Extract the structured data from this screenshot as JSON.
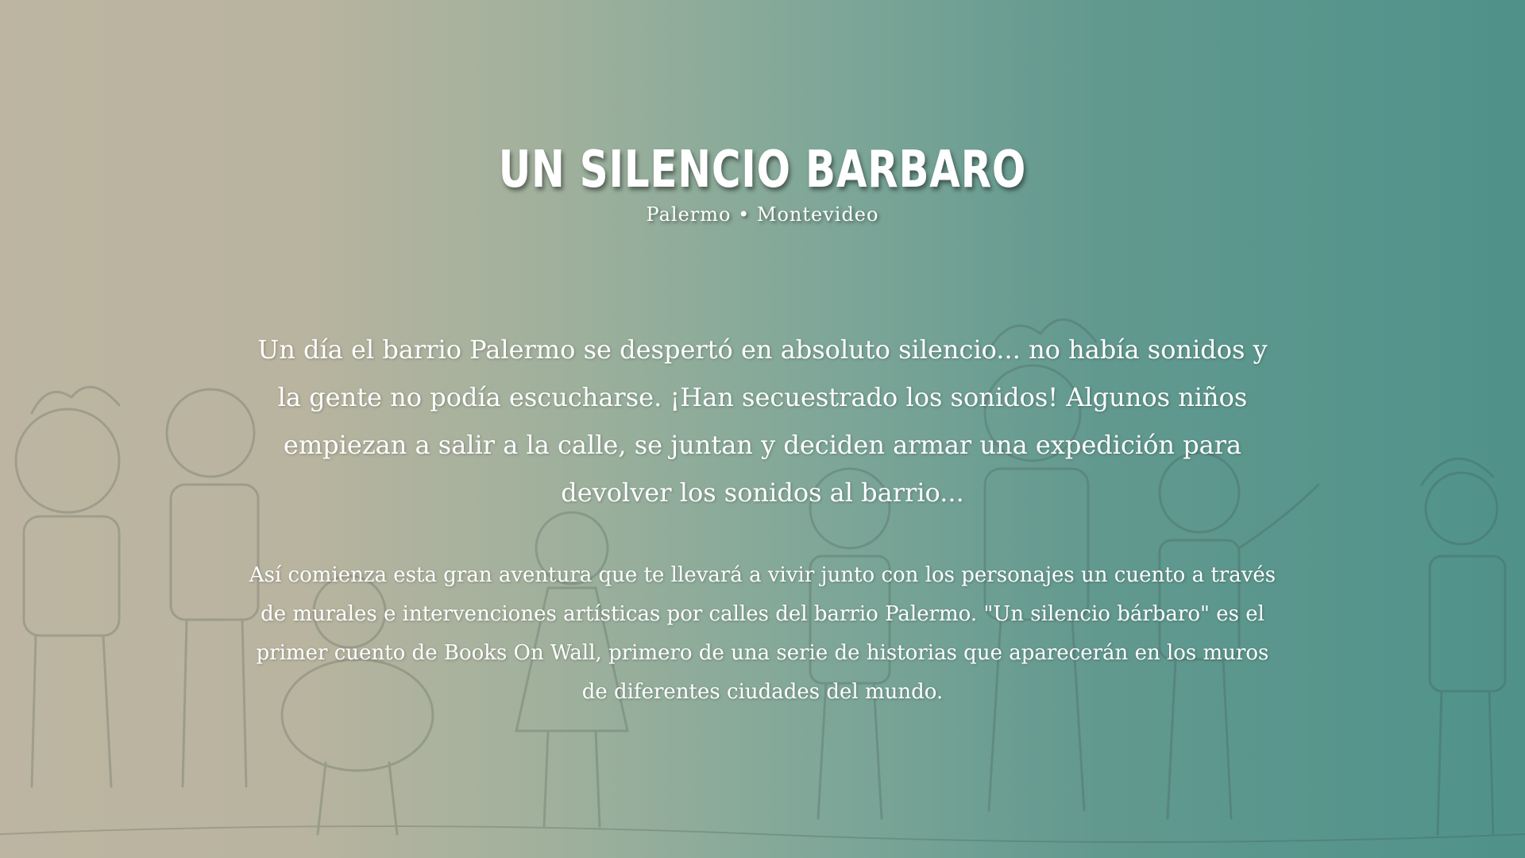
{
  "header": {
    "title": "UN SILENCIO BARBARO",
    "subtitle": "Palermo • Montevideo"
  },
  "main": {
    "intro": "Un día el barrio Palermo se despertó en absoluto silencio... no había sonidos y la gente no podía escucharse. ¡Han secuestrado los sonidos! Algunos niños empiezan a salir a la calle, se juntan y deciden armar una expedición para devolver los sonidos al barrio...",
    "description": "Así comienza esta gran aventura que te llevará a vivir junto con los personajes un cuento a través de murales e intervenciones artísticas por calles del barrio Palermo. \"Un silencio bárbaro\" es el primer cuento de Books On Wall, primero de una serie de historias que aparecerán en los muros de diferentes ciudades del mundo."
  },
  "colors": {
    "gradient_left": "#bdb5a1",
    "gradient_right": "#4f928a",
    "text": "#ffffff"
  }
}
